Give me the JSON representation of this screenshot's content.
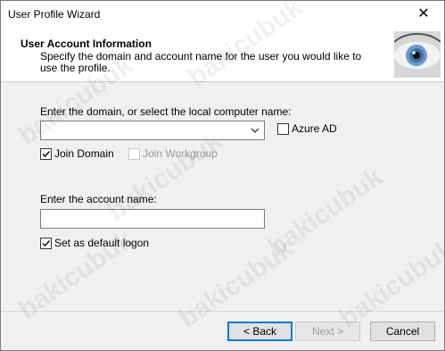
{
  "window": {
    "title": "User Profile Wizard"
  },
  "header": {
    "title": "User Account  Information",
    "subtitle": "Specify the domain and account name for the user you would like to use the profile."
  },
  "domain_section": {
    "label": "Enter the domain, or select the local computer name:",
    "value": "",
    "azure_ad": {
      "label": "Azure AD",
      "checked": false
    },
    "join_domain": {
      "label": "Join Domain",
      "checked": true
    },
    "join_workgroup": {
      "label": "Join Workgroup",
      "checked": false,
      "disabled": true
    }
  },
  "account_section": {
    "label": "Enter the account name:",
    "value": "",
    "default_logon": {
      "label": "Set as default logon",
      "checked": true
    }
  },
  "buttons": {
    "back": "< Back",
    "next": "Next >",
    "cancel": "Cancel"
  },
  "watermark": {
    "text": "bakicubuk"
  }
}
